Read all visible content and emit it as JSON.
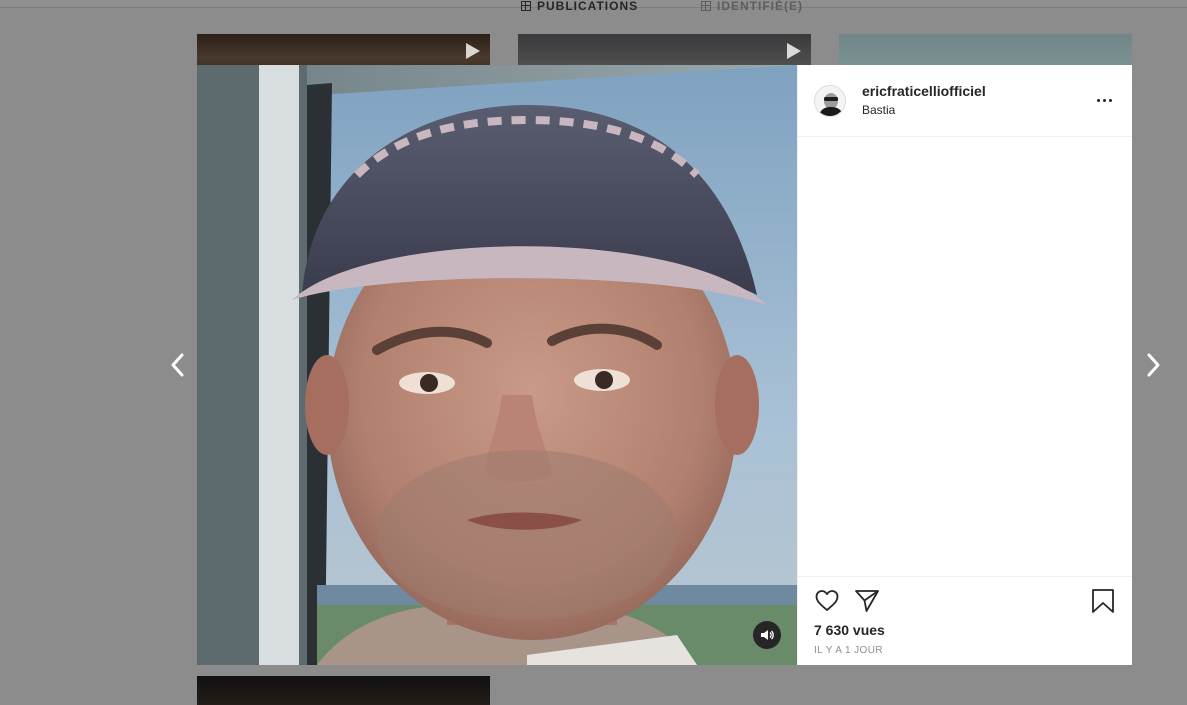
{
  "profile_tabs": {
    "posts_label": "PUBLICATIONS",
    "tagged_label": "IDENTIFIÉ(E)"
  },
  "post": {
    "username": "ericfraticelliofficiel",
    "location": "Bastia",
    "views": "7 630 vues",
    "time": "IL Y A 1 JOUR"
  },
  "icons": {
    "like": "heart-icon",
    "share": "paper-plane-icon",
    "save": "bookmark-icon",
    "more": "ellipsis-icon",
    "audio": "speaker-icon",
    "prev": "chevron-left-icon",
    "next": "chevron-right-icon"
  },
  "colors": {
    "overlay": "#8c8c8c",
    "text_primary": "#262626",
    "text_secondary": "#8e8e8e",
    "divider": "#efefef"
  }
}
